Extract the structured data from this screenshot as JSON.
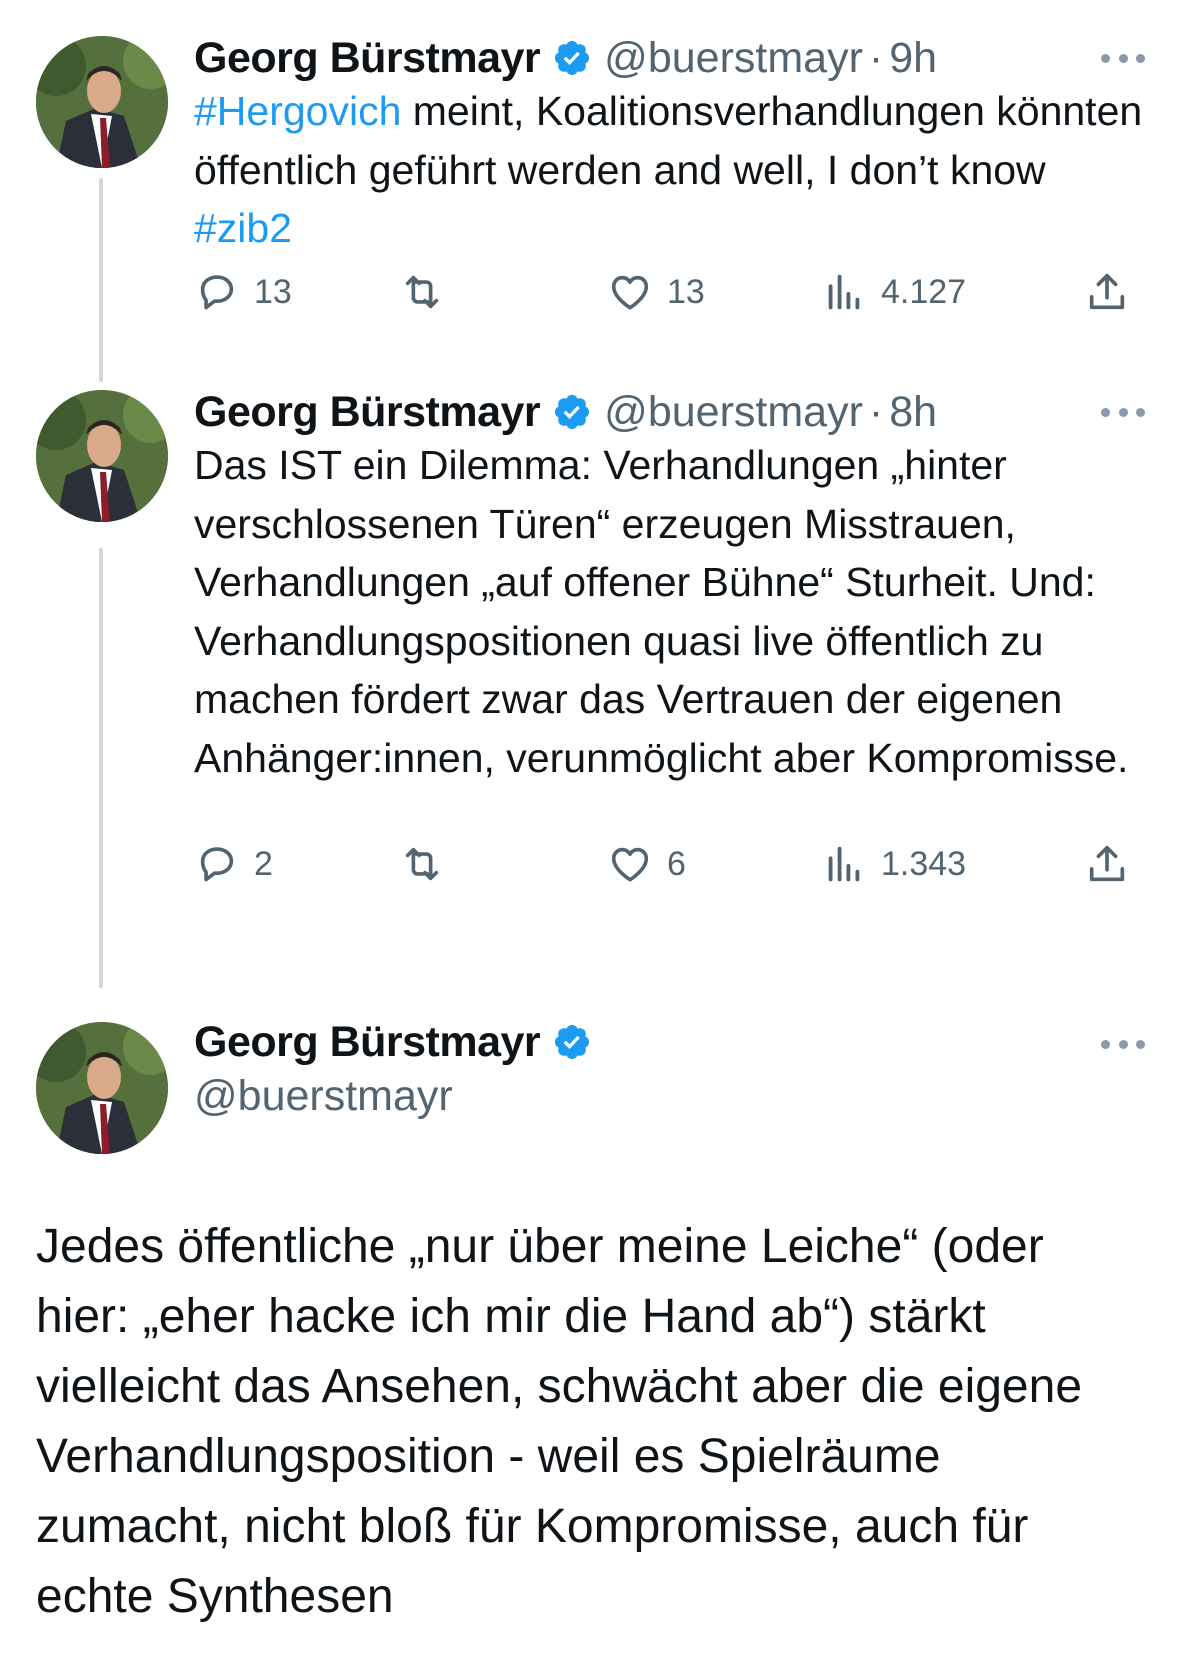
{
  "colors": {
    "accent": "#1d9bf0",
    "secondary_text": "#536471",
    "thread_line": "#cfd9de"
  },
  "tweets": [
    {
      "name": "Georg Bürstmayr",
      "handle": "@buerstmayr",
      "sep": "·",
      "time": "9h",
      "text": {
        "hashtag1": "#Hergovich",
        "middle": " meint, Koalitionsverhandlungen könnten öffentlich geführt werden and well, I don’t know ",
        "hashtag2": "#zib2"
      },
      "replies": "13",
      "likes": "13",
      "views": "4.127"
    },
    {
      "name": "Georg Bürstmayr",
      "handle": "@buerstmayr",
      "sep": "·",
      "time": "8h",
      "text": "Das IST ein Dilemma: Verhandlungen „hinter verschlossenen Türen“ erzeugen Misstrauen, Verhandlungen „auf offener Bühne“ Sturheit. Und: Verhandlungspositionen quasi live öffentlich zu machen fördert zwar das Vertrauen der eigenen Anhänger:innen, verunmöglicht aber Kompromisse.",
      "replies": "2",
      "likes": "6",
      "views": "1.343"
    }
  ],
  "main_tweet": {
    "name": "Georg Bürstmayr",
    "handle": "@buerstmayr",
    "text": "Jedes öffentliche „nur über meine Leiche“ (oder hier: „eher hacke ich mir die Hand ab“) stärkt vielleicht das Ansehen, schwächt aber die eigene Verhandlungsposition - weil es Spielräume zumacht, nicht bloß für Kompromisse, auch für echte Synthesen"
  }
}
